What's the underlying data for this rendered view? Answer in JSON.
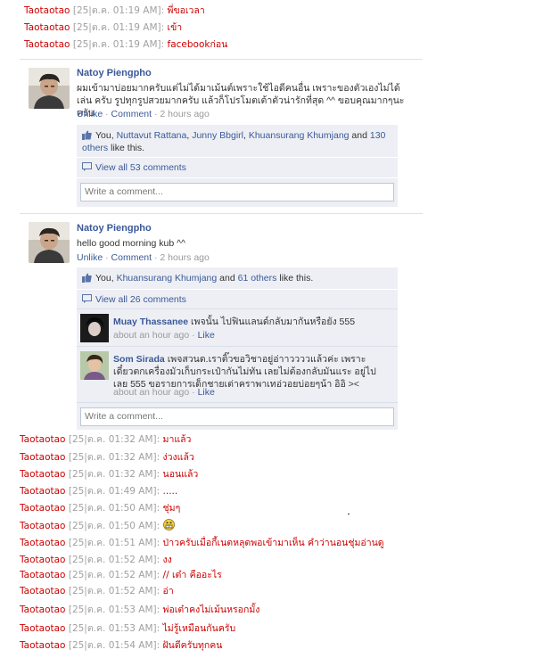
{
  "chat_top": [
    {
      "nick": "Taotaotao",
      "ts": "[25|ต.ค. 01:19 AM]",
      "msg": "พี่ขอเวลา"
    },
    {
      "nick": "Taotaotao",
      "ts": "[25|ต.ค. 01:19 AM]",
      "msg": "เข้า"
    },
    {
      "nick": "Taotaotao",
      "ts": "[25|ต.ค. 01:19 AM]",
      "msg": "facebookก่อน"
    }
  ],
  "post1": {
    "author": "Natoy Piengpho",
    "text": "ผมเข้ามาบ่อยมากครับแต่ไม่ได้มาเม้นต์เพราะใช้ไอดีคนอื่น เพราะของตัวเองไม่ได้เล่น ครับ รูปทุกรูปสวยมากครับ แล้วก็โปรโมตเต้าตัวน่ารักที่สุด ^^ ขอบคุณมากๆนะครับ",
    "unlike": "Unlike",
    "comment": "Comment",
    "time": "2 hours ago",
    "likes_you": "You,",
    "likes_p1": "Nuttavut Rattana",
    "likes_p2": "Junny Bbgirl",
    "likes_p3": "Khuansurang Khumjang",
    "likes_and": "and",
    "likes_others": "130 others",
    "likes_tail": "like this.",
    "view_all": "View all 53 comments",
    "write_comment": "Write a comment..."
  },
  "post2": {
    "author": "Natoy Piengpho",
    "text": "hello good morning kub ^^",
    "unlike": "Unlike",
    "comment": "Comment",
    "time": "2 hours ago",
    "likes_you": "You,",
    "likes_p1": "Khuansurang Khumjang",
    "likes_and": "and",
    "likes_others": "61 others",
    "likes_tail": "like this.",
    "view_all": "View all 26 comments",
    "comments": [
      {
        "author": "Muay Thassanee",
        "text": "เพจนั้น ไปฟินแลนด์กลับมากันหรือยัง 555",
        "time": "about an hour ago",
        "like": "Like"
      },
      {
        "author": "Som Sirada",
        "text": "เพจสวนด.เราติ๊วขอวิชาอยู่อ่าาววววแล้วค่ะ เพราะเดี๋ยวตกเครื่องมัวเก็บกระเป๋ากันไม่ทัน เลยไม่ต้องกลับมันแระ อยู่ไปเลย 555 ขอรายการเด็กชายเต่าคราพาเทอ่วอยบ่อยๆน้า อิอิ ><",
        "time": "about an hour ago",
        "like": "Like"
      }
    ],
    "write_comment": "Write a comment..."
  },
  "chat_bottom": [
    {
      "nick": "Taotaotao",
      "ts": "[25|ต.ค. 01:32 AM]",
      "msg": "มาแล้ว"
    },
    {
      "nick": "Taotaotao",
      "ts": "[25|ต.ค. 01:32 AM]",
      "msg": "ง่วงแล้ว"
    },
    {
      "nick": "Taotaotao",
      "ts": "[25|ต.ค. 01:32 AM]",
      "msg": "นอนแล้ว"
    },
    {
      "nick": "Taotaotao",
      "ts": "[25|ต.ค. 01:49 AM]",
      "msg": "....."
    },
    {
      "nick": "Taotaotao",
      "ts": "[25|ต.ค. 01:50 AM]",
      "msg": "ชุ่มๆ"
    },
    {
      "nick": "Taotaotao",
      "ts": "[25|ต.ค. 01:50 AM]",
      "msg": ""
    },
    {
      "nick": "Taotaotao",
      "ts": "[25|ต.ค. 01:51 AM]",
      "msg": "ป่าวครับเมื่อกี้เนตหลุดพอเข้ามาเห็น คำว่านอนชุ่มอ่านดู"
    },
    {
      "nick": "Taotaotao",
      "ts": "[25|ต.ค. 01:52 AM]",
      "msg": "งง"
    },
    {
      "nick": "Taotaotao",
      "ts": "[25|ต.ค. 01:52 AM]",
      "msg": "// เต๋า คืออะไร"
    },
    {
      "nick": "Taotaotao",
      "ts": "[25|ต.ค. 01:52 AM]",
      "msg": "อ่า"
    },
    {
      "nick": "Taotaotao",
      "ts": "[25|ต.ค. 01:53 AM]",
      "msg": "พ่อเต๋าคงไม่เม้นหรอกมั้ง"
    },
    {
      "nick": "Taotaotao",
      "ts": "[25|ต.ค. 01:53 AM]",
      "msg": "ไม่รู้เหมือนกันครับ"
    },
    {
      "nick": "Taotaotao",
      "ts": "[25|ต.ค. 01:54 AM]",
      "msg": "ฝันดีครับทุกคน"
    }
  ],
  "colors": {
    "nick": "#cc0000",
    "timestamp": "#a0a0a0",
    "fb_link": "#3b5998",
    "ufi_bg": "#edeff4"
  },
  "icons": {
    "like": "thumbs-up-icon",
    "comment": "comment-bubble-icon",
    "smiley": "grin-emoji-icon"
  }
}
